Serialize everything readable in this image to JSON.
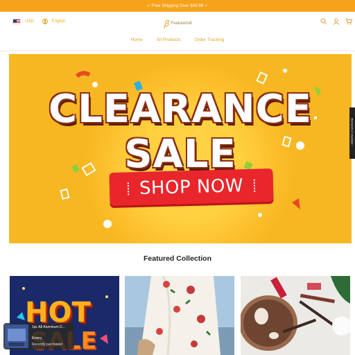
{
  "topbar": {
    "text": "✓ Free Shipping Over $49.99 ✓"
  },
  "header": {
    "currency": "USD",
    "language": "English",
    "logo_mark": "ꞵ",
    "logo_name": "Featurenoll"
  },
  "nav": {
    "items": [
      "Home",
      "All Products",
      "Order Tracking"
    ]
  },
  "banner": {
    "line1": "CLEARANCE",
    "line2": "SALE",
    "cta": "SHOP NOW"
  },
  "side_tab": {
    "label": "RECENTLY VIEWED ‹"
  },
  "featured": {
    "title": "Featured Collection"
  },
  "cards": [
    {
      "name": "hot-sale-card",
      "text1": "HOT",
      "text2": "SALE"
    },
    {
      "name": "floral-dress-card"
    },
    {
      "name": "makeup-card"
    }
  ],
  "popup": {
    "product": "1pc A8 Aluminum D...",
    "buyer": "Emery",
    "status": "Recently purchased"
  },
  "colors": {
    "accent": "#f7a21b",
    "banner": "#f7b723",
    "cta": "#e8262b"
  }
}
